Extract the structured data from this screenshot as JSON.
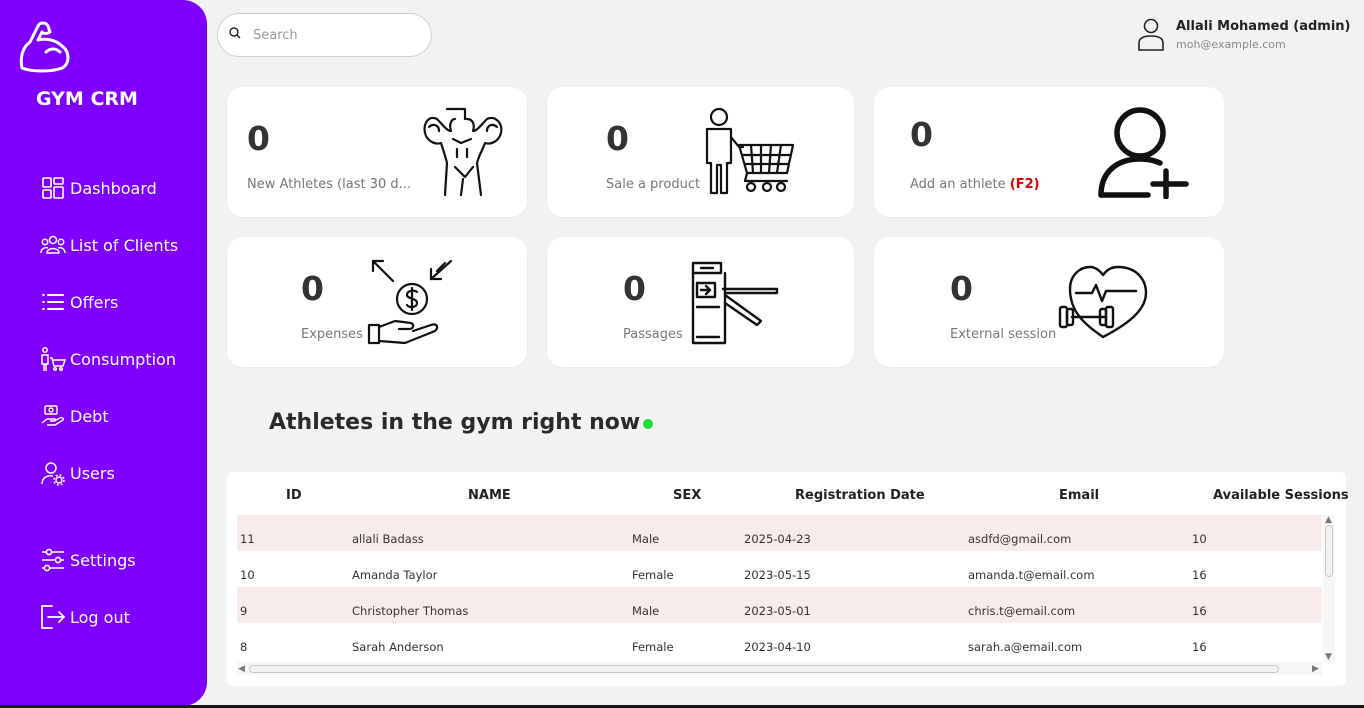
{
  "brand": {
    "name": "GYM CRM",
    "icon": "flexed-bicep-icon"
  },
  "sidebar": {
    "items": [
      {
        "label": "Dashboard",
        "icon": "grid-icon"
      },
      {
        "label": "List of Clients",
        "icon": "group-icon"
      },
      {
        "label": "Offers",
        "icon": "list-icon"
      },
      {
        "label": "Consumption",
        "icon": "cart-person-icon"
      },
      {
        "label": "Debt",
        "icon": "hand-money-icon"
      },
      {
        "label": "Users",
        "icon": "user-gear-icon"
      },
      {
        "label": "Settings",
        "icon": "sliders-icon"
      },
      {
        "label": "Log out",
        "icon": "logout-icon"
      }
    ]
  },
  "search": {
    "placeholder": "Search"
  },
  "user": {
    "name": "Allali Mohamed (admin)",
    "email": "moh@example.com"
  },
  "cards": [
    {
      "value": "0",
      "label": "New Athletes (last 30 d...",
      "icon": "bodybuilder-icon"
    },
    {
      "value": "0",
      "label": "Sale a product",
      "icon": "shopping-cart-person-icon"
    },
    {
      "value": "0",
      "label": "Add an athlete",
      "shortcut": "(F2)",
      "icon": "add-user-icon"
    },
    {
      "value": "0",
      "label": "Expenses",
      "icon": "hand-coin-icon"
    },
    {
      "value": "0",
      "label": "Passages",
      "icon": "turnstile-icon"
    },
    {
      "value": "0",
      "label": "External session",
      "icon": "heart-dumbbell-icon"
    }
  ],
  "section": {
    "title": "Athletes in the gym right now",
    "status_color": "#1ddc3a"
  },
  "table": {
    "columns": [
      "ID",
      "NAME",
      "SEX",
      "Registration Date",
      "Email",
      "Available Sessions"
    ],
    "rows": [
      [
        "11",
        "allali Badass",
        "Male",
        "2025-04-23",
        "asdfd@gmail.com",
        "10"
      ],
      [
        "10",
        "Amanda Taylor",
        "Female",
        "2023-05-15",
        "amanda.t@email.com",
        "16"
      ],
      [
        "9",
        "Christopher Thomas",
        "Male",
        "2023-05-01",
        "chris.t@email.com",
        "16"
      ],
      [
        "8",
        "Sarah Anderson",
        "Female",
        "2023-04-10",
        "sarah.a@email.com",
        "16"
      ]
    ]
  },
  "colors": {
    "sidebar": "#7f00ff",
    "background": "#f2f2f2",
    "alt_row": "#f8ebeb",
    "shortcut": "#dd0000"
  }
}
